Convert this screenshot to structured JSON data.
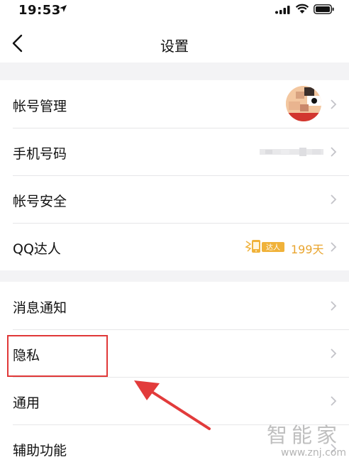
{
  "status_bar": {
    "time": "19:53",
    "icons": [
      "location-arrow-icon",
      "signal-icon",
      "wifi-icon",
      "battery-icon"
    ]
  },
  "nav": {
    "title": "设置",
    "back_icon": "chevron-left-icon"
  },
  "section1": [
    {
      "label": "帐号管理",
      "accessory": "avatar"
    },
    {
      "label": "手机号码",
      "accessory": "masked-phone"
    },
    {
      "label": "帐号安全"
    },
    {
      "label": "QQ达人",
      "badge_text": "达人",
      "days": "199天"
    }
  ],
  "section2": [
    {
      "label": "消息通知"
    },
    {
      "label": "隐私"
    },
    {
      "label": "通用"
    },
    {
      "label": "辅助功能"
    }
  ],
  "watermark": {
    "text": "智能家",
    "url": "www.znj.com"
  },
  "colors": {
    "background": "#f3f3f5",
    "badge": "#f0b23a",
    "highlight": "#e03838",
    "chevron": "#c3c3c8"
  }
}
